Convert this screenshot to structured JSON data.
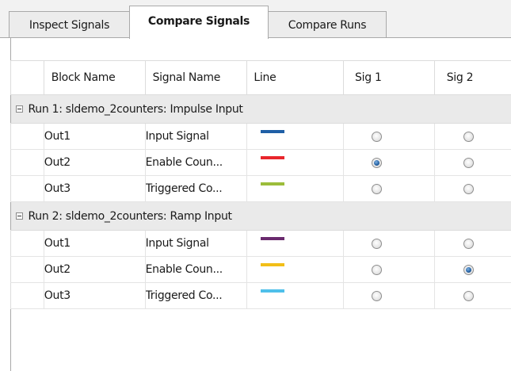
{
  "tabs": [
    {
      "label": "Inspect Signals",
      "active": false
    },
    {
      "label": "Compare Signals",
      "active": true
    },
    {
      "label": "Compare Runs",
      "active": false
    }
  ],
  "table": {
    "headers": {
      "block_name": "Block Name",
      "signal_name": "Signal Name",
      "line": "Line",
      "sig1": "Sig 1",
      "sig2": "Sig 2"
    },
    "groups": [
      {
        "label": "Run 1: sldemo_2counters: Impulse Input",
        "expanded": true,
        "rows": [
          {
            "block": "Out1",
            "signal": "Input Signal",
            "line_color": "#1f5fa6",
            "sig1_selected": false,
            "sig2_selected": false
          },
          {
            "block": "Out2",
            "signal": "Enable Coun...",
            "line_color": "#e8262c",
            "sig1_selected": true,
            "sig2_selected": false
          },
          {
            "block": "Out3",
            "signal": "Triggered Co...",
            "line_color": "#9cbd3a",
            "sig1_selected": false,
            "sig2_selected": false
          }
        ]
      },
      {
        "label": "Run 2: sldemo_2counters: Ramp Input",
        "expanded": true,
        "rows": [
          {
            "block": "Out1",
            "signal": "Input Signal",
            "line_color": "#6a2a6e",
            "sig1_selected": false,
            "sig2_selected": false
          },
          {
            "block": "Out2",
            "signal": "Enable Coun...",
            "line_color": "#f2bf18",
            "sig1_selected": false,
            "sig2_selected": true
          },
          {
            "block": "Out3",
            "signal": "Triggered Co...",
            "line_color": "#4fc0ea",
            "sig1_selected": false,
            "sig2_selected": false
          }
        ]
      }
    ]
  }
}
